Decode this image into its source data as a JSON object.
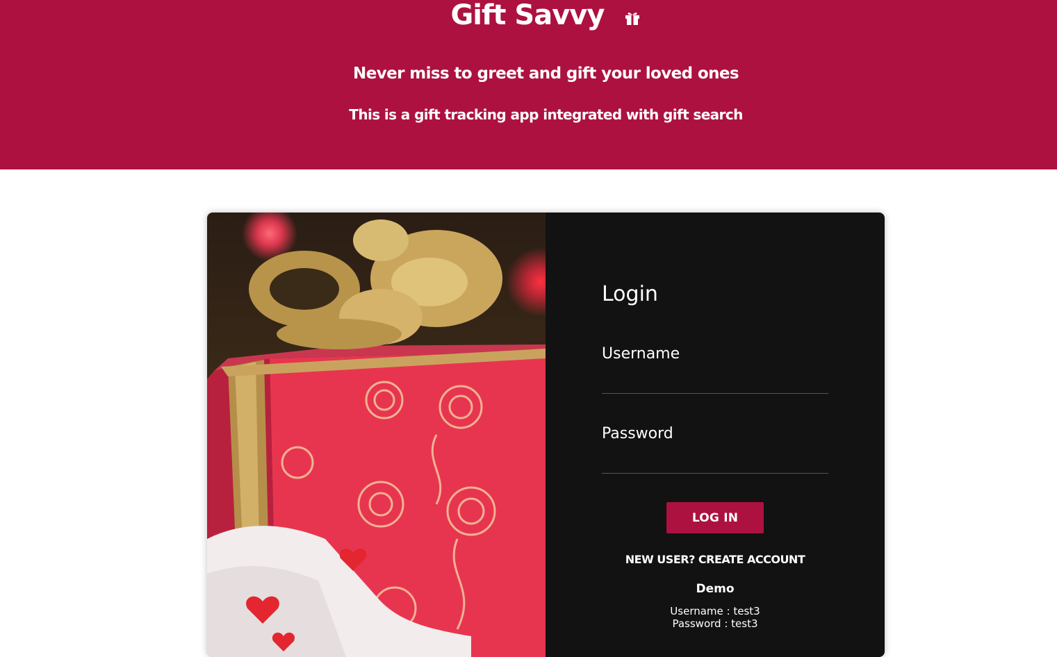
{
  "header": {
    "title": "Gift Savvy",
    "tagline": "Never miss to greet and gift your loved ones",
    "subtagline": "This is a gift tracking app integrated with gift search",
    "icon": "gift-icon",
    "background_color": "#ad113f"
  },
  "login": {
    "heading": "Login",
    "username_label": "Username",
    "username_value": "",
    "password_label": "Password",
    "password_value": "",
    "login_button": "LOG IN",
    "create_account_link": "NEW USER? CREATE ACCOUNT",
    "demo_title": "Demo",
    "demo_username": "Username : test3",
    "demo_password": "Password : test3",
    "panel_color": "#121212",
    "accent_color": "#ad113f"
  },
  "image": {
    "subject": "red-gift-box-with-gold-ribbon-photo"
  }
}
